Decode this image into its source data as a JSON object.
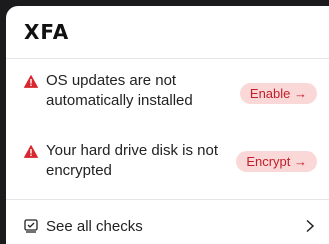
{
  "brand": {
    "logo": "XFA"
  },
  "alerts": [
    {
      "text": "OS updates are not automatically installed",
      "action_label": "Enable →",
      "icon": "warning-triangle-icon"
    },
    {
      "text": "Your hard drive disk is not encrypted",
      "action_label": "Encrypt →",
      "icon": "warning-triangle-icon"
    }
  ],
  "footer": {
    "label": "See all checks",
    "icon": "checklist-icon",
    "trailing_icon": "chevron-right-icon"
  },
  "colors": {
    "warning": "#d9272e",
    "pill_bg": "#fbd8d8",
    "pill_text": "#c0202a"
  }
}
